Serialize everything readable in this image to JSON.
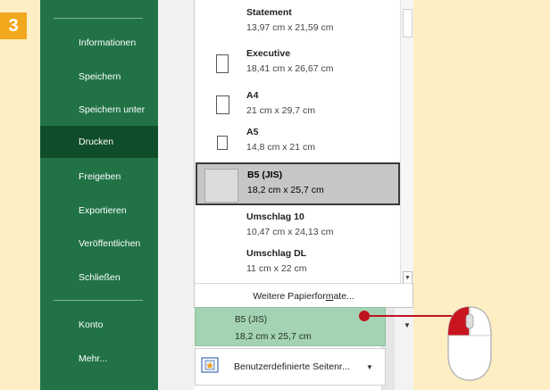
{
  "step_badge": "3",
  "sidebar": {
    "items": [
      {
        "label": "Informationen"
      },
      {
        "label": "Speichern"
      },
      {
        "label": "Speichern unter"
      },
      {
        "label": "Drucken"
      },
      {
        "label": "Freigeben"
      },
      {
        "label": "Exportieren"
      },
      {
        "label": "Veröffentlichen"
      },
      {
        "label": "Schließen"
      },
      {
        "label": "Konto"
      },
      {
        "label": "Mehr..."
      }
    ],
    "active_item": "Drucken"
  },
  "paper_list": [
    {
      "name": "Statement",
      "size": "13,97 cm x 21,59 cm"
    },
    {
      "name": "Executive",
      "size": "18,41 cm x 26,67 cm"
    },
    {
      "name": "A4",
      "size": "21 cm x 29,7 cm"
    },
    {
      "name": "A5",
      "size": "14,8 cm x 21 cm"
    },
    {
      "name": "B5 (JIS)",
      "size": "18,2 cm x 25,7 cm"
    },
    {
      "name": "Umschlag 10",
      "size": "10,47 cm x 24,13 cm"
    },
    {
      "name": "Umschlag DL",
      "size": "11 cm x 22 cm"
    }
  ],
  "selected_paper": "B5 (JIS)",
  "more_formats": {
    "before": "Weitere Papierfor",
    "underlined": "m",
    "after": "ate..."
  },
  "current_paper": {
    "name": "B5 (JIS)",
    "size": "18,2 cm x 25,7 cm"
  },
  "margins_dropdown": {
    "label": "Benutzerdefinierte Seitenr..."
  },
  "colors": {
    "sidebar_green": "#217346",
    "sidebar_active": "#0f4d2a",
    "selected_size_green": "#a3d3b2",
    "badge_orange": "#f2a81d",
    "pointer_red": "#c0121f",
    "background": "#fdefc3"
  },
  "icons": [
    "scroll-up-icon",
    "scroll-down-icon",
    "dropdown-arrow-icon",
    "page-margins-icon",
    "mouse-click-icon"
  ]
}
